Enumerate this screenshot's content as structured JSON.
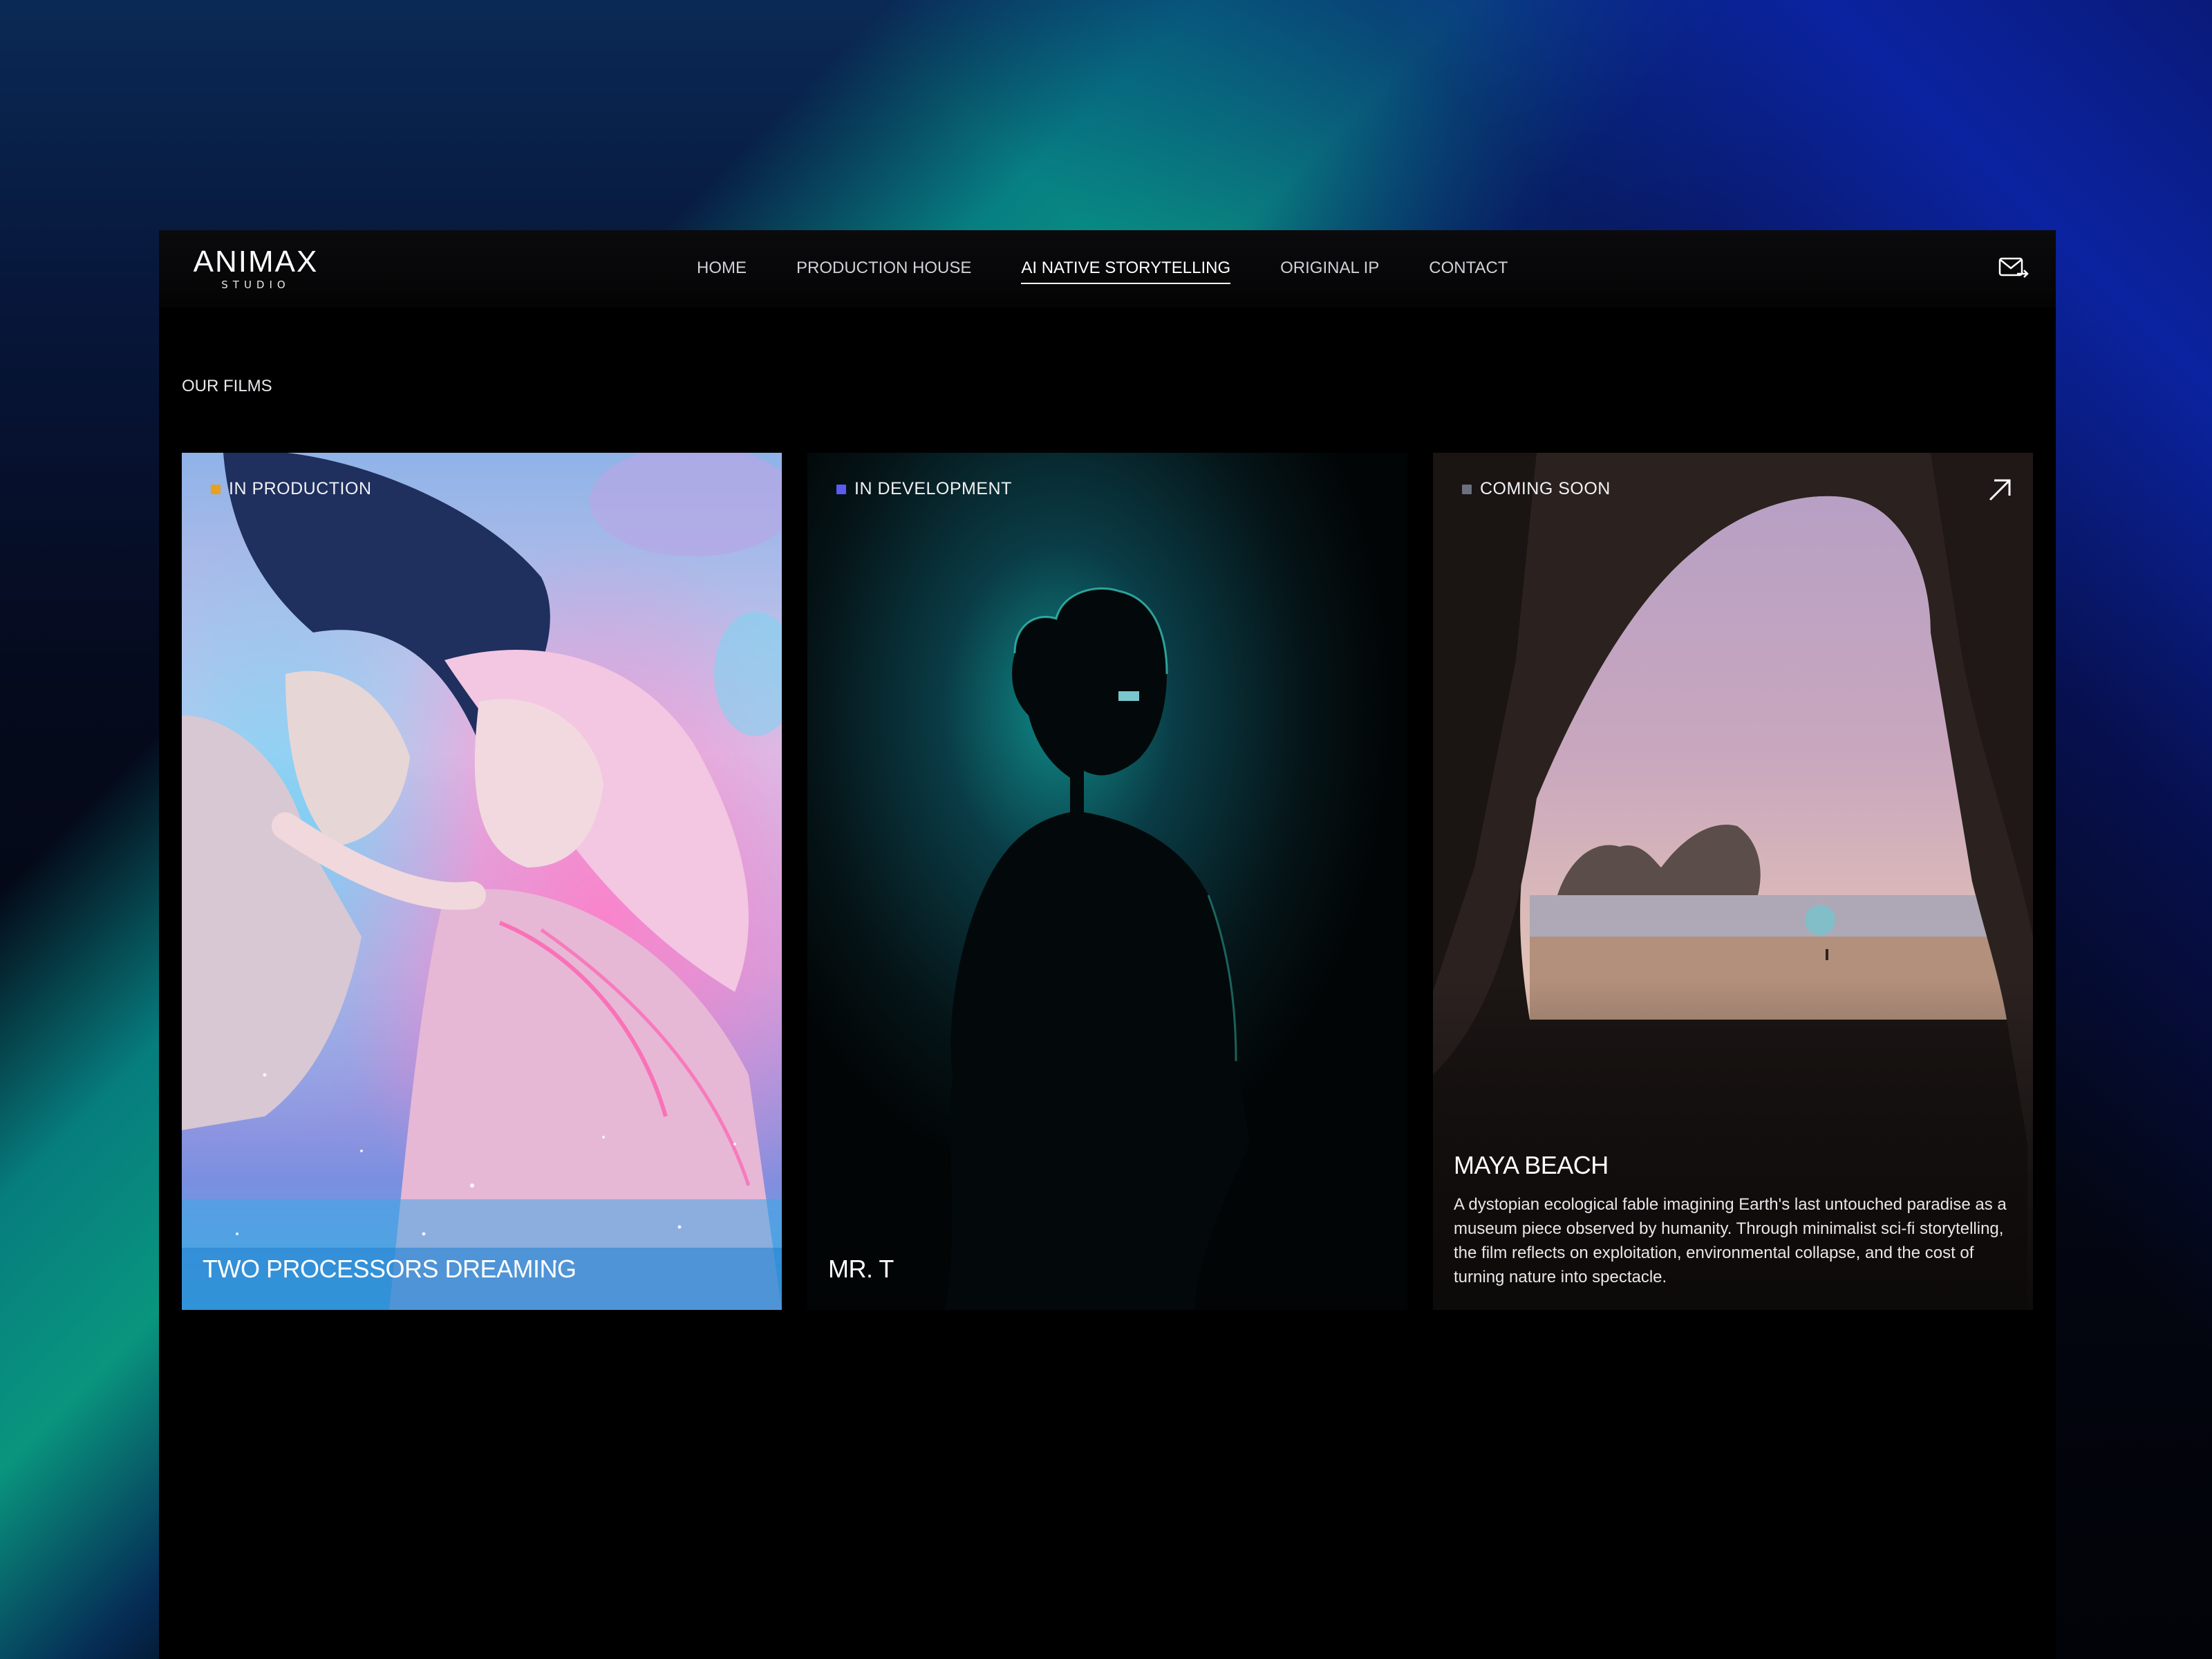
{
  "brand": {
    "name": "ANIMAX",
    "sub": "STUDIO"
  },
  "nav": {
    "items": [
      {
        "label": "HOME",
        "active": false
      },
      {
        "label": "PRODUCTION HOUSE",
        "active": false
      },
      {
        "label": "AI NATIVE STORYTELLING",
        "active": true
      },
      {
        "label": "ORIGINAL IP",
        "active": false
      },
      {
        "label": "CONTACT",
        "active": false
      }
    ],
    "mail_icon": "mail-forward-icon"
  },
  "section": {
    "title": "OUR FILMS"
  },
  "films": [
    {
      "status": "IN PRODUCTION",
      "status_color": "#e8a020",
      "title": "TWO PROCESSORS DREAMING"
    },
    {
      "status": "IN DEVELOPMENT",
      "status_color": "#5b5bf0",
      "title": "MR. T"
    },
    {
      "status": "COMING SOON",
      "status_color": "#6c6f7c",
      "title": "MAYA BEACH",
      "description": "A dystopian ecological fable imagining Earth's last untouched paradise as a museum piece observed by humanity. Through minimalist sci-fi storytelling, the film reflects on exploitation, environmental collapse, and the cost of turning nature into spectacle.",
      "open_icon": "arrow-up-right-icon"
    }
  ]
}
